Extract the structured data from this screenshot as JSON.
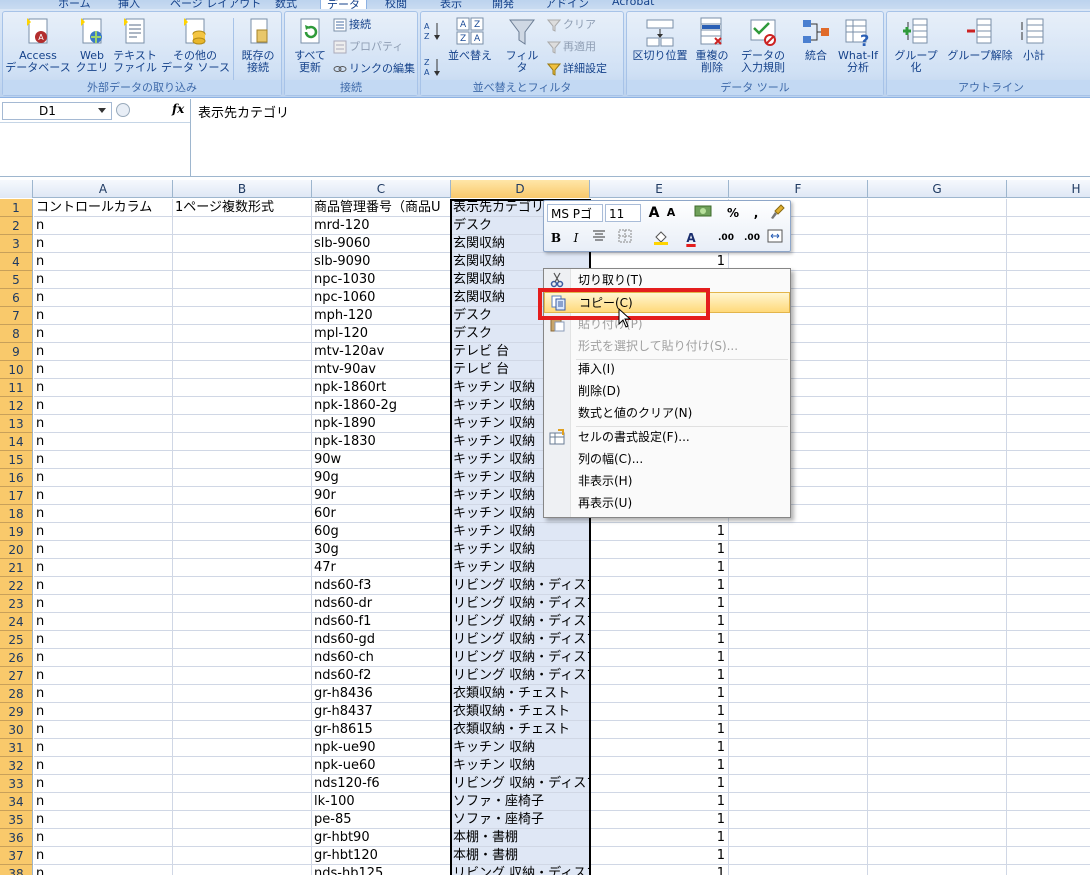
{
  "ribbon": {
    "tabs": [
      "ホーム",
      "挿入",
      "ページ レイアウト",
      "数式",
      "データ",
      "校閲",
      "表示",
      "開発",
      "アドイン",
      "Acrobat"
    ],
    "active_tab": "データ",
    "groups": {
      "external": {
        "label": "外部データの取り込み",
        "access": "Access\nデータベース",
        "web": "Web\nクエリ",
        "text": "テキスト\nファイル",
        "other": "その他の\nデータ ソース",
        "existing": "既存の\n接続"
      },
      "connections": {
        "label": "接続",
        "refresh_all": "すべて\n更新",
        "connections": "接続",
        "properties": "プロパティ",
        "edit_links": "リンクの編集"
      },
      "sort_filter": {
        "label": "並べ替えとフィルタ",
        "sort": "並べ替え",
        "filter": "フィルタ",
        "clear": "クリア",
        "reapply": "再適用",
        "advanced": "詳細設定"
      },
      "data_tools": {
        "label": "データ ツール",
        "text_to_columns": "区切り位置",
        "remove_duplicates": "重複の\n削除",
        "validation": "データの\n入力規則",
        "consolidate": "統合",
        "whatif": "What-If\n分析"
      },
      "outline": {
        "label": "アウトライン",
        "group": "グループ化",
        "ungroup": "グループ解除",
        "subtotal": "小計"
      }
    }
  },
  "formula_bar": {
    "name_box": "D1",
    "fx": "fx",
    "content": "表示先カテゴリ"
  },
  "columns": [
    "A",
    "B",
    "C",
    "D",
    "E",
    "F",
    "G",
    "H"
  ],
  "selected_column": "D",
  "rows": [
    {
      "n": "1",
      "A": "コントロールカラム",
      "B": "1ページ複数形式",
      "C": "商品管理番号（商品U",
      "D": "表示先カテゴリ",
      "E": ""
    },
    {
      "n": "2",
      "A": "n",
      "B": "",
      "C": "mrd-120",
      "D": "デスク",
      "E": ""
    },
    {
      "n": "3",
      "A": "n",
      "B": "",
      "C": "slb-9060",
      "D": "玄関収納",
      "E": ""
    },
    {
      "n": "4",
      "A": "n",
      "B": "",
      "C": "slb-9090",
      "D": "玄関収納",
      "E": "1"
    },
    {
      "n": "5",
      "A": "n",
      "B": "",
      "C": "npc-1030",
      "D": "玄関収納",
      "E": ""
    },
    {
      "n": "6",
      "A": "n",
      "B": "",
      "C": "npc-1060",
      "D": "玄関収納",
      "E": ""
    },
    {
      "n": "7",
      "A": "n",
      "B": "",
      "C": "mph-120",
      "D": "デスク",
      "E": ""
    },
    {
      "n": "8",
      "A": "n",
      "B": "",
      "C": "mpl-120",
      "D": "デスク",
      "E": ""
    },
    {
      "n": "9",
      "A": "n",
      "B": "",
      "C": "mtv-120av",
      "D": "テレビ 台",
      "E": ""
    },
    {
      "n": "10",
      "A": "n",
      "B": "",
      "C": "mtv-90av",
      "D": "テレビ 台",
      "E": ""
    },
    {
      "n": "11",
      "A": "n",
      "B": "",
      "C": "npk-1860rt",
      "D": "キッチン 収納",
      "E": ""
    },
    {
      "n": "12",
      "A": "n",
      "B": "",
      "C": "npk-1860-2g",
      "D": "キッチン 収納",
      "E": ""
    },
    {
      "n": "13",
      "A": "n",
      "B": "",
      "C": "npk-1890",
      "D": "キッチン 収納",
      "E": ""
    },
    {
      "n": "14",
      "A": "n",
      "B": "",
      "C": "npk-1830",
      "D": "キッチン 収納",
      "E": ""
    },
    {
      "n": "15",
      "A": "n",
      "B": "",
      "C": "90w",
      "D": "キッチン 収納",
      "E": ""
    },
    {
      "n": "16",
      "A": "n",
      "B": "",
      "C": "90g",
      "D": "キッチン 収納",
      "E": ""
    },
    {
      "n": "17",
      "A": "n",
      "B": "",
      "C": "90r",
      "D": "キッチン 収納",
      "E": ""
    },
    {
      "n": "18",
      "A": "n",
      "B": "",
      "C": "60r",
      "D": "キッチン 収納",
      "E": ""
    },
    {
      "n": "19",
      "A": "n",
      "B": "",
      "C": "60g",
      "D": "キッチン 収納",
      "E": "1"
    },
    {
      "n": "20",
      "A": "n",
      "B": "",
      "C": "30g",
      "D": "キッチン 収納",
      "E": "1"
    },
    {
      "n": "21",
      "A": "n",
      "B": "",
      "C": "47r",
      "D": "キッチン 収納",
      "E": "1"
    },
    {
      "n": "22",
      "A": "n",
      "B": "",
      "C": "nds60-f3",
      "D": "リビング 収納・ディスプ",
      "E": "1"
    },
    {
      "n": "23",
      "A": "n",
      "B": "",
      "C": "nds60-dr",
      "D": "リビング 収納・ディスプ",
      "E": "1"
    },
    {
      "n": "24",
      "A": "n",
      "B": "",
      "C": "nds60-f1",
      "D": "リビング 収納・ディスプ",
      "E": "1"
    },
    {
      "n": "25",
      "A": "n",
      "B": "",
      "C": "nds60-gd",
      "D": "リビング 収納・ディスプ",
      "E": "1"
    },
    {
      "n": "26",
      "A": "n",
      "B": "",
      "C": "nds60-ch",
      "D": "リビング 収納・ディスプ",
      "E": "1"
    },
    {
      "n": "27",
      "A": "n",
      "B": "",
      "C": "nds60-f2",
      "D": "リビング 収納・ディスプ",
      "E": "1"
    },
    {
      "n": "28",
      "A": "n",
      "B": "",
      "C": "gr-h8436",
      "D": "衣類収納・チェスト",
      "E": "1"
    },
    {
      "n": "29",
      "A": "n",
      "B": "",
      "C": "gr-h8437",
      "D": "衣類収納・チェスト",
      "E": "1"
    },
    {
      "n": "30",
      "A": "n",
      "B": "",
      "C": "gr-h8615",
      "D": "衣類収納・チェスト",
      "E": "1"
    },
    {
      "n": "31",
      "A": "n",
      "B": "",
      "C": "npk-ue90",
      "D": "キッチン 収納",
      "E": "1"
    },
    {
      "n": "32",
      "A": "n",
      "B": "",
      "C": "npk-ue60",
      "D": "キッチン 収納",
      "E": "1"
    },
    {
      "n": "33",
      "A": "n",
      "B": "",
      "C": "nds120-f6",
      "D": "リビング 収納・ディスプ",
      "E": "1"
    },
    {
      "n": "34",
      "A": "n",
      "B": "",
      "C": "lk-100",
      "D": "ソファ・座椅子",
      "E": "1"
    },
    {
      "n": "35",
      "A": "n",
      "B": "",
      "C": "pe-85",
      "D": "ソファ・座椅子",
      "E": "1"
    },
    {
      "n": "36",
      "A": "n",
      "B": "",
      "C": "gr-hbt90",
      "D": "本棚・書棚",
      "E": "1"
    },
    {
      "n": "37",
      "A": "n",
      "B": "",
      "C": "gr-hbt120",
      "D": "本棚・書棚",
      "E": "1"
    },
    {
      "n": "38",
      "A": "n",
      "B": "",
      "C": "nds-hb125",
      "D": "リビング 収納・ディスプ",
      "E": "1"
    }
  ],
  "mini_toolbar": {
    "font": "MS Pゴ",
    "size": "11",
    "grow": "A",
    "shrink": "A",
    "percent": "%",
    "comma": ",",
    "bold": "B",
    "italic": "I",
    "font_color": "A",
    "inc_decimal": ".00",
    "dec_decimal": ".00"
  },
  "context_menu": {
    "cut": "切り取り(T)",
    "copy": "コピー(C)",
    "paste": "貼り付け(P)",
    "paste_special": "形式を選択して貼り付け(S)...",
    "insert": "挿入(I)",
    "delete": "削除(D)",
    "clear": "数式と値のクリア(N)",
    "format_cells": "セルの書式設定(F)...",
    "column_width": "列の幅(C)...",
    "hide": "非表示(H)",
    "unhide": "再表示(U)",
    "highlighted": "copy"
  },
  "colors": {
    "highlight_frame": "#e41d1d",
    "selected_header": "#f9c96b",
    "selected_column_fill": "#dfe7f5"
  }
}
